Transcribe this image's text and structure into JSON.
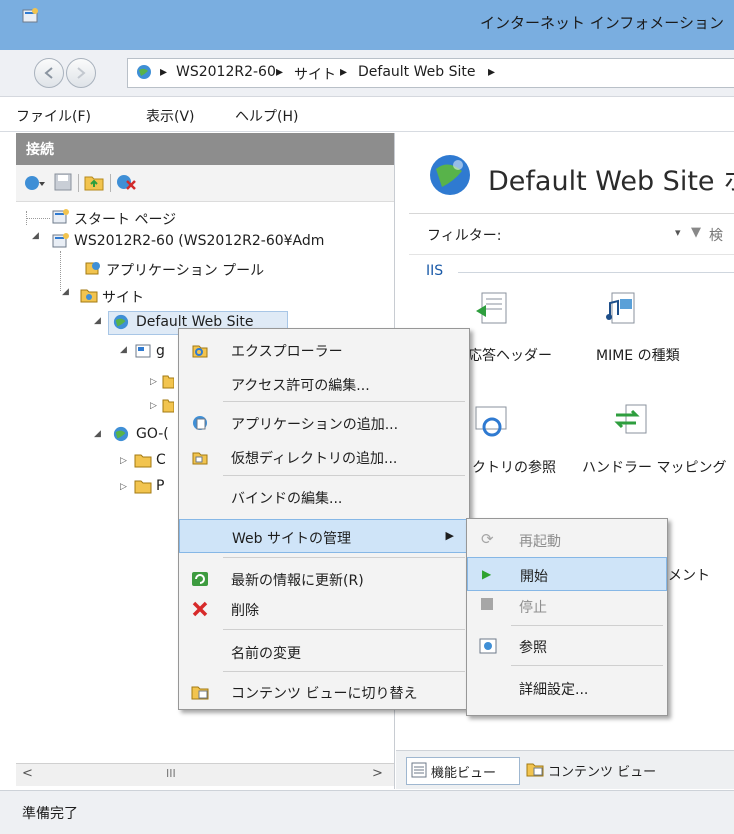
{
  "window": {
    "title": "インターネット インフォメーション"
  },
  "address": {
    "crumbs": [
      "WS2012R2-60",
      "サイト",
      "Default Web Site"
    ]
  },
  "menu": {
    "items": [
      "ファイル(F)",
      "表示(V)",
      "ヘルプ(H)"
    ]
  },
  "connections": {
    "header": "接続",
    "tree": {
      "start_page": "スタート ページ",
      "server": "WS2012R2-60 (WS2012R2-60¥Adm",
      "app_pools": "アプリケーション プール",
      "sites": "サイト",
      "default_site": "Default Web Site",
      "child_g": "g",
      "go_site": "GO-(",
      "folder_c": "C",
      "folder_p": "P"
    },
    "scroll_mark": "III"
  },
  "feature_panel": {
    "title": "Default Web Site ホ",
    "filter_label": "フィルター:",
    "search_label": "検",
    "group": "IIS",
    "features": [
      "応答ヘッダー",
      "MIME の種類",
      "クトリの参照",
      "ハンドラー マッピング",
      "メント"
    ]
  },
  "view_tabs": {
    "features": "機能ビュー",
    "content": "コンテンツ ビュー"
  },
  "status": {
    "text": "準備完了"
  },
  "context_menu": {
    "items": {
      "explore": "エクスプローラー",
      "edit_perms": "アクセス許可の編集...",
      "add_app": "アプリケーションの追加...",
      "add_vdir": "仮想ディレクトリの追加...",
      "edit_bind": "バインドの編集...",
      "manage": "Web サイトの管理",
      "refresh": "最新の情報に更新(R)",
      "delete": "削除",
      "rename": "名前の変更",
      "switch_content": "コンテンツ ビューに切り替え"
    }
  },
  "submenu": {
    "items": {
      "restart": "再起動",
      "start": "開始",
      "stop": "停止",
      "browse": "参照",
      "advanced": "詳細設定..."
    }
  },
  "colors": {
    "titlebar": "#7aaee0",
    "highlight": "#cfe4f8",
    "link_blue": "#1a5aa8"
  }
}
